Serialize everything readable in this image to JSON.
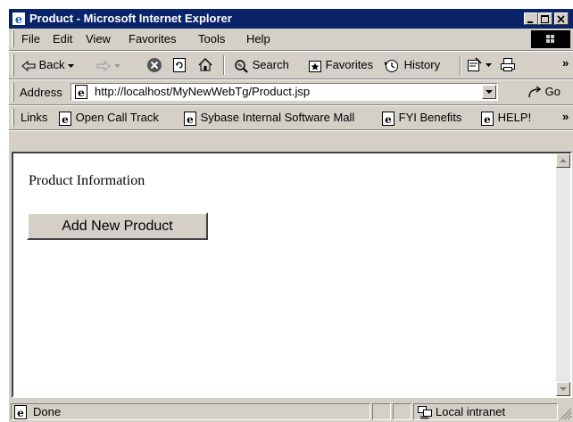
{
  "window": {
    "title": "Product - Microsoft Internet Explorer"
  },
  "menu": {
    "items": [
      "File",
      "Edit",
      "View",
      "Favorites",
      "Tools",
      "Help"
    ]
  },
  "toolbar": {
    "back_label": "Back",
    "search_label": "Search",
    "favorites_label": "Favorites",
    "history_label": "History",
    "overflow": "»"
  },
  "address": {
    "label": "Address",
    "url": "http://localhost/MyNewWebTg/Product.jsp",
    "go_label": "Go"
  },
  "links": {
    "label": "Links",
    "items": [
      "Open Call Track",
      "Sybase Internal Software Mall",
      "FYI Benefits",
      "HELP!"
    ],
    "overflow": "»"
  },
  "page": {
    "heading": "Product Information",
    "button_label": "Add New Product"
  },
  "status": {
    "text": "Done",
    "zone": "Local intranet"
  },
  "colors": {
    "titlebar": "#0a246a",
    "chrome": "#d4d0c8",
    "content_bg": "#ffffff"
  }
}
